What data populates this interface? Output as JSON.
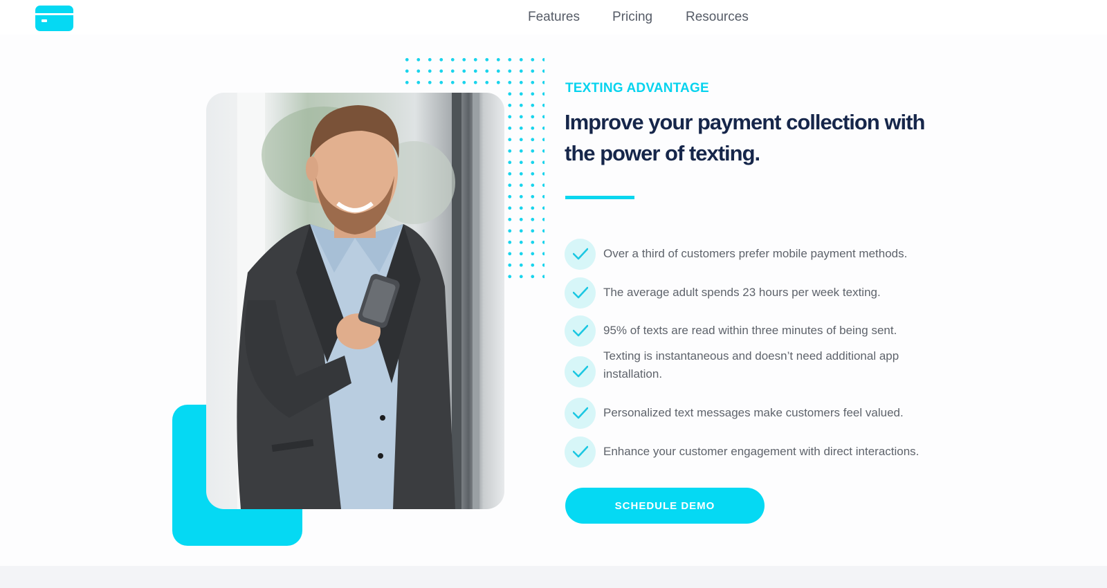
{
  "header": {
    "logo_icon": "credit-card-icon",
    "nav": [
      {
        "label": "Features"
      },
      {
        "label": "Pricing"
      },
      {
        "label": "Resources"
      }
    ]
  },
  "hero": {
    "eyebrow": "TEXTING ADVANTAGE",
    "headline_line1": "Improve your payment collection with",
    "headline_line2": "the power of texting.",
    "features": [
      {
        "icon": "check-icon",
        "text_line1": "Over a third of customers prefer mobile payment methods.",
        "text_line2": ""
      },
      {
        "icon": "check-icon",
        "text_line1": "The average adult spends 23 hours per week texting.",
        "text_line2": ""
      },
      {
        "icon": "check-icon",
        "text_line1": "95% of texts are read within three minutes of being sent.",
        "text_line2": ""
      },
      {
        "icon": "check-icon",
        "text_line1": "Texting is instantaneous and doesn’t need additional app",
        "text_line2": " installation."
      },
      {
        "icon": "check-icon",
        "text_line1": "Personalized text messages make customers feel valued.",
        "text_line2": ""
      },
      {
        "icon": "check-icon",
        "text_line1": "Enhance your customer engagement with direct interactions.",
        "text_line2": ""
      }
    ],
    "cta_label": "SCHEDULE DEMO"
  },
  "colors": {
    "accent": "#05d9f3",
    "headline": "#16264a",
    "body_text": "#5e636b",
    "check_bg": "#d7f6f8"
  }
}
